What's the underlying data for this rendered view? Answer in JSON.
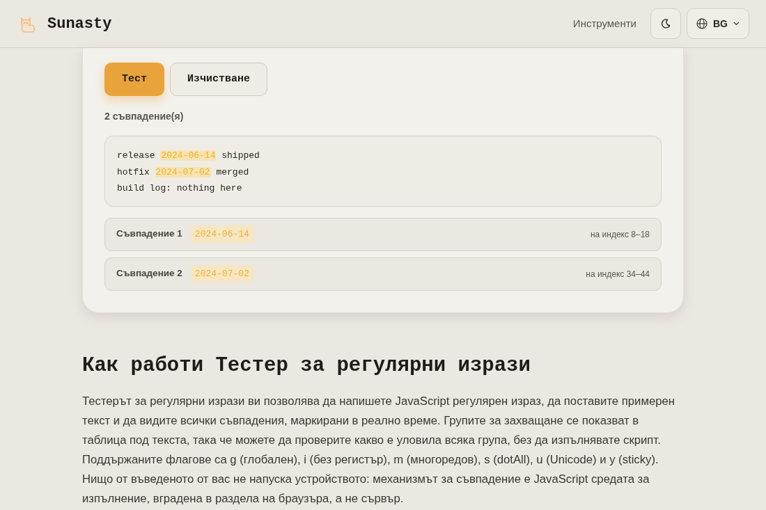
{
  "header": {
    "logo_text": "Sunasty",
    "nav_link": "Инструменти",
    "language": "BG"
  },
  "actions": [
    {
      "label": "Тест",
      "kind": "primary"
    },
    {
      "label": "Изчистване",
      "kind": "secondary"
    }
  ],
  "match_count": "2 съвпадение(я)",
  "test_text": {
    "lines": [
      [
        {
          "text": "release ",
          "highlighted": false
        },
        {
          "text": "2024-06-14",
          "highlighted": true
        },
        {
          "text": " shipped",
          "highlighted": false
        }
      ],
      [
        {
          "text": "hotfix ",
          "highlighted": false
        },
        {
          "text": "2024-07-02",
          "highlighted": true
        },
        {
          "text": " merged",
          "highlighted": false
        }
      ],
      [
        {
          "text": "build log: nothing here",
          "highlighted": false
        }
      ]
    ]
  },
  "matches": [
    {
      "label": "Съвпадение 1",
      "value": "2024-06-14",
      "position": "на индекс 8–18"
    },
    {
      "label": "Съвпадение 2",
      "value": "2024-07-02",
      "position": "на индекс 34–44"
    }
  ],
  "section": {
    "heading": "Как работи Тестер за регулярни изрази",
    "body": "Тестерът за регулярни изрази ви позволява да напишете JavaScript регулярен израз, да поставите примерен текст и да видите всички съвпадения, маркирани в реално време. Групите за захващане се показват в таблица под текста, така че можете да проверите какво е уловила всяка група, без да изпълнявате скрипт. Поддържаните флагове са g (глобален), i (без регистър), m (многоредов), s (dotAll), u (Unicode) и y (sticky). Нищо от въведеното от вас не напуска устройството: механизмът за съвпадение е JavaScript средата за изпълнение, вградена в раздела на браузъра, а не сървър."
  }
}
